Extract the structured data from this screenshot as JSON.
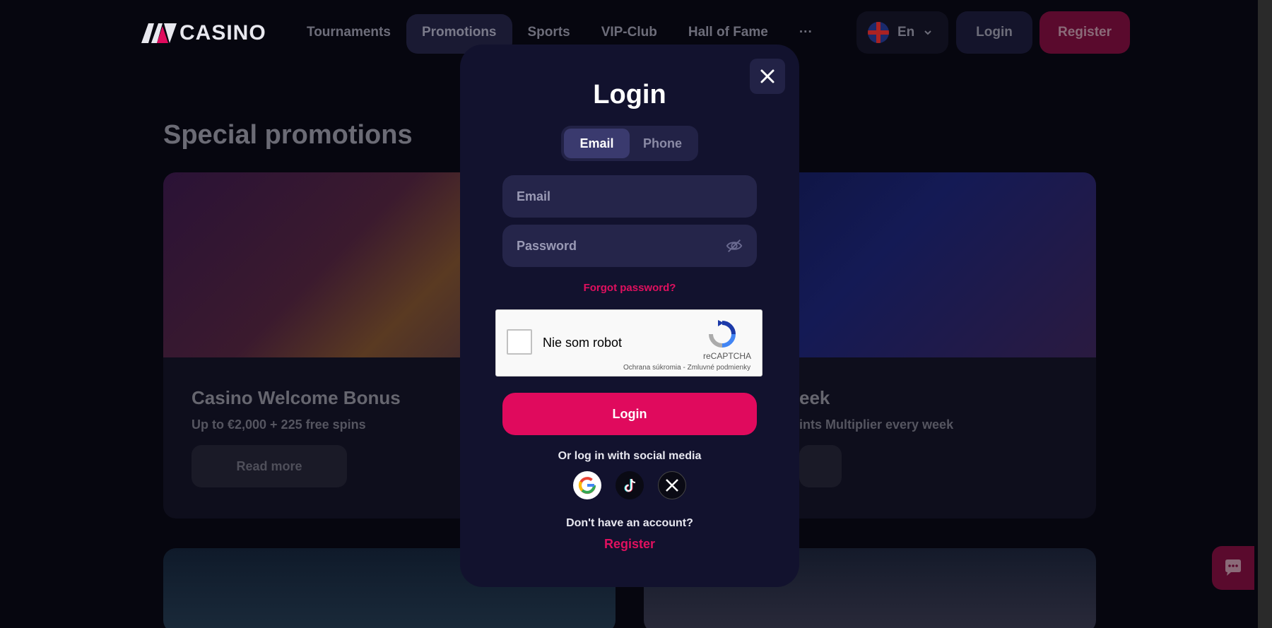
{
  "header": {
    "logo_text": "CASINO",
    "nav": [
      "Tournaments",
      "Promotions",
      "Sports",
      "VIP-Club",
      "Hall of Fame",
      "···"
    ],
    "active_nav_index": 1,
    "language": "En",
    "login_label": "Login",
    "register_label": "Register"
  },
  "page": {
    "section_title": "Special promotions",
    "cards": [
      {
        "title": "Casino Welcome Bonus",
        "subtitle": "Up to €2,000 + 225 free spins",
        "button": "Read more"
      },
      {
        "title": "eek",
        "subtitle": "ints Multiplier every week",
        "button": ""
      }
    ]
  },
  "modal": {
    "title": "Login",
    "tabs": [
      "Email",
      "Phone"
    ],
    "active_tab_index": 0,
    "email_placeholder": "Email",
    "password_placeholder": "Password",
    "forgot_password": "Forgot password?",
    "captcha": {
      "label": "Nie som robot",
      "brand": "reCAPTCHA",
      "links": "Ochrana súkromia - Zmluvné podmienky"
    },
    "login_button": "Login",
    "social_label": "Or log in with social media",
    "social_icons": [
      "google-icon",
      "tiktok-icon",
      "x-icon"
    ],
    "no_account": "Don't have an account?",
    "register_link": "Register"
  },
  "colors": {
    "accent": "#e00a5d",
    "modal_bg": "#12122e",
    "field_bg": "#25254a"
  }
}
